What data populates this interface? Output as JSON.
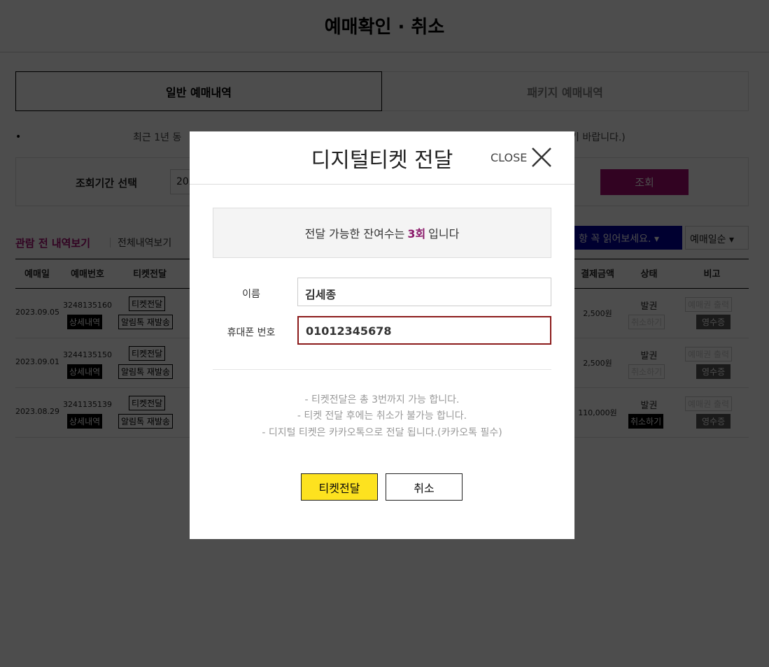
{
  "page": {
    "title": "예매확인 · 취소",
    "tabs": [
      {
        "label": "일반 예매내역"
      },
      {
        "label": "패키지 예매내역"
      }
    ],
    "notice_left": "최근 1년 동",
    "notice_right": "기 바랍니다.)",
    "search": {
      "label": "조회기간 선택",
      "date_value": "202",
      "button": "조회"
    },
    "links": {
      "before_view": "관람 전 내역보기",
      "all_view": "전체내역보기"
    },
    "notice_dropdown": "항 꼭 읽어보세요.",
    "sort_dropdown": "예매일순",
    "columns": [
      "예매일",
      "예매번호",
      "티켓전달",
      "결제금액",
      "상태",
      "비고"
    ],
    "rows": [
      {
        "date": "2023.09.05",
        "number": "3248135160",
        "detail": "상세내역",
        "transfer": "티켓전달",
        "resend": "알림톡 재발송",
        "amount": "2,500원",
        "status": "발권",
        "cancel": "취소하기",
        "print": "예매권 출력",
        "receipt": "영수증"
      },
      {
        "date": "2023.09.01",
        "number": "3244135150",
        "detail": "상세내역",
        "transfer": "티켓전달",
        "resend": "알림톡 재발송",
        "amount": "2,500원",
        "status": "발권",
        "cancel": "취소하기",
        "print": "예매권 출력",
        "receipt": "영수증"
      },
      {
        "date": "2023.08.29",
        "number": "3241135139",
        "detail": "상세내역",
        "transfer": "티켓전달",
        "resend": "알림톡 재발송",
        "amount": "110,000원",
        "status": "발권",
        "cancel": "취소하기",
        "print": "예매권 출력",
        "receipt": "영수증"
      }
    ]
  },
  "modal": {
    "title": "디지털티켓 전달",
    "close": "CLOSE",
    "info_prefix": "전달 가능한 잔여수는",
    "info_count": "3회",
    "info_suffix": "입니다",
    "name_label": "이름",
    "name_value": "김세종",
    "phone_label": "휴대폰 번호",
    "phone_value": "01012345678",
    "notes": [
      "- 티켓전달은 총 3번까지 가능 합니다.",
      "- 티켓 전달 후에는 취소가 불가능 합니다.",
      "- 디지털 티켓은 카카오톡으로 전달 됩니다.(카카오톡 필수)"
    ],
    "send_button": "티켓전달",
    "cancel_button": "취소"
  },
  "colors": {
    "accent": "#a50a74",
    "send": "#fde21f",
    "phone_border": "#8b1a1a"
  }
}
